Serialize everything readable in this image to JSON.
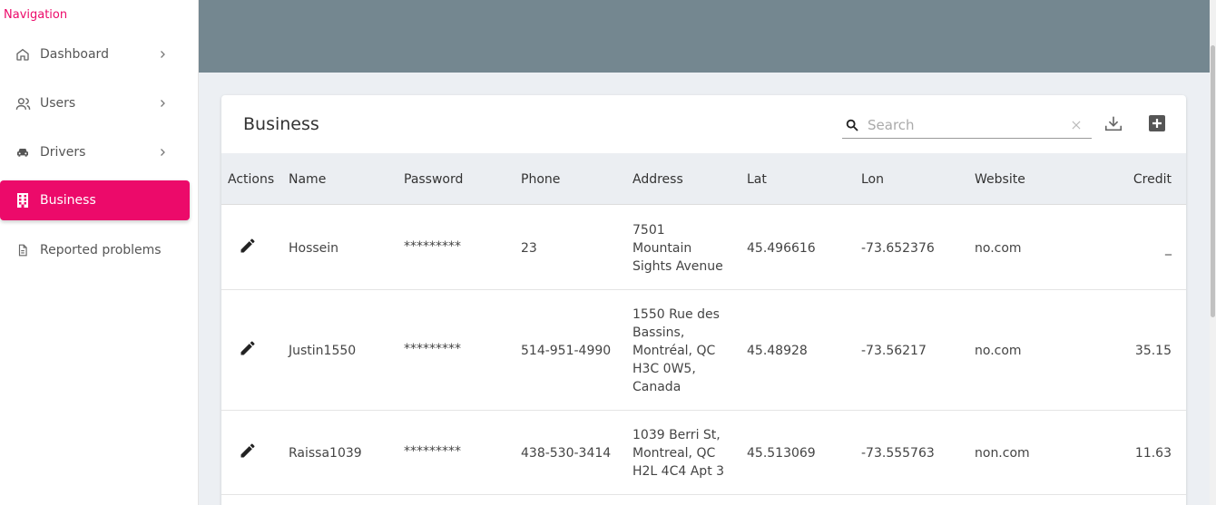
{
  "sidebar": {
    "heading": "Navigation",
    "items": [
      {
        "label": "Dashboard"
      },
      {
        "label": "Users"
      },
      {
        "label": "Drivers"
      },
      {
        "label": "Business"
      },
      {
        "label": "Reported problems"
      }
    ]
  },
  "card": {
    "title": "Business",
    "search_placeholder": "Search"
  },
  "table": {
    "columns": [
      "Actions",
      "Name",
      "Password",
      "Phone",
      "Address",
      "Lat",
      "Lon",
      "Website",
      "Credit"
    ],
    "rows": [
      {
        "name": "Hossein",
        "password": "*********",
        "phone": "23",
        "address": [
          "7501",
          "Mountain",
          "Sights Avenue"
        ],
        "lat": "45.496616",
        "lon": "-73.652376",
        "website": "no.com",
        "credit": "_"
      },
      {
        "name": "Justin1550",
        "password": "*********",
        "phone": "514-951-4990",
        "address": [
          "1550 Rue des",
          "Bassins,",
          "Montréal, QC",
          "H3C 0W5,",
          "Canada"
        ],
        "lat": "45.48928",
        "lon": "-73.56217",
        "website": "no.com",
        "credit": "35.15"
      },
      {
        "name": "Raissa1039",
        "password": "*********",
        "phone": "438-530-3414",
        "address": [
          "1039 Berri St,",
          "Montreal, QC",
          "H2L 4C4 Apt 3"
        ],
        "lat": "45.513069",
        "lon": "-73.555763",
        "website": "non.com",
        "credit": "11.63"
      }
    ]
  },
  "colors": {
    "accent": "#ec0a6a",
    "header_band": "#748790",
    "page_bg": "#eceff3"
  }
}
